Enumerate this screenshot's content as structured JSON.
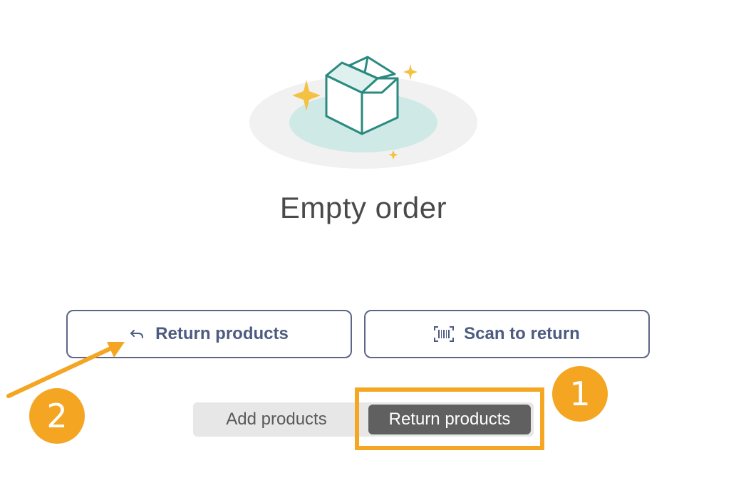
{
  "empty_state": {
    "title": "Empty order"
  },
  "actions": {
    "return_label": "Return products",
    "scan_label": "Scan to return"
  },
  "mode_toggle": {
    "options": [
      "Add products",
      "Return products"
    ],
    "selected": "Return products"
  },
  "annotations": {
    "badge_1": "1",
    "badge_2": "2",
    "accent_color": "#f5a623"
  },
  "icons": {
    "return": "undo-icon",
    "scan": "barcode-icon",
    "illustration": "open-box-icon"
  },
  "colors": {
    "button_text": "#4d5b80",
    "selected_segment": "#606060",
    "box_stroke": "#2a8a80",
    "sparkle": "#f5c142"
  }
}
